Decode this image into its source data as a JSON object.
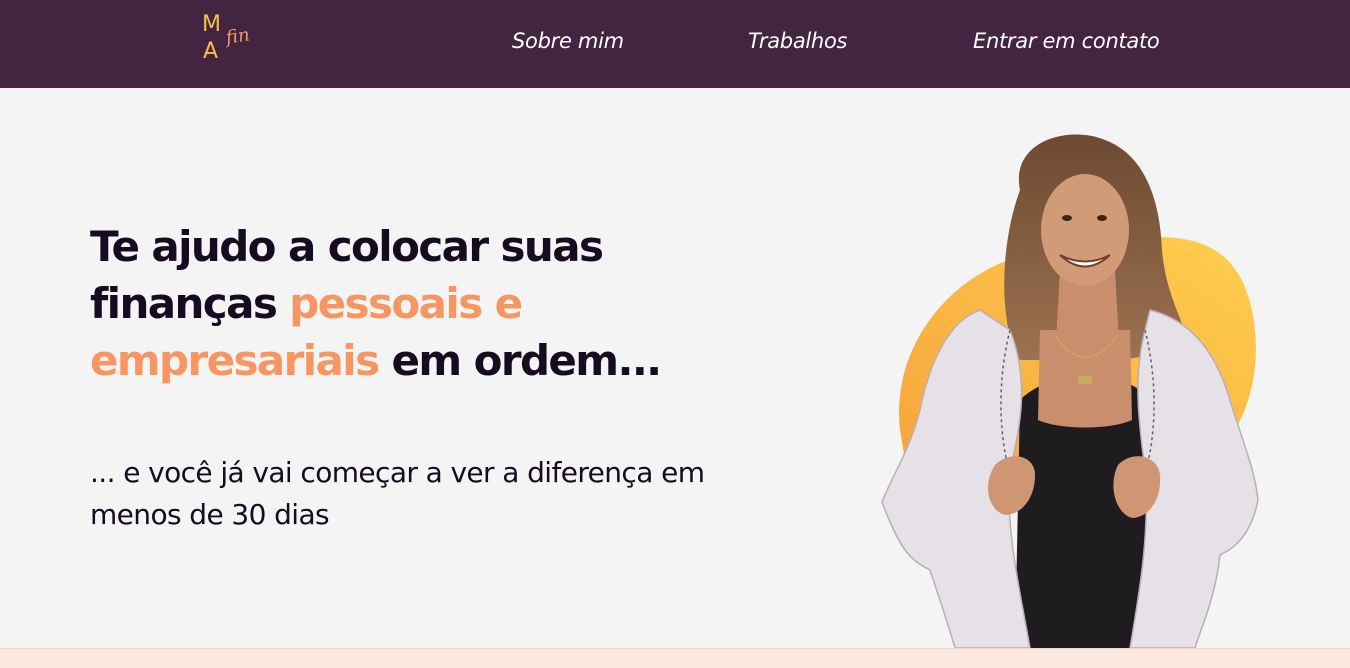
{
  "logo": {
    "letter_m": "M",
    "letter_a": "A",
    "script": "fin"
  },
  "nav": {
    "about": "Sobre mim",
    "works": "Trabalhos",
    "contact": "Entrar em contato"
  },
  "hero": {
    "headline_part1": "Te ajudo a colocar suas finanças ",
    "headline_accent": "pessoais e empresariais",
    "headline_part2": " em ordem...",
    "subline": "... e você já vai começar a ver a diferença em menos de 30 dias"
  },
  "colors": {
    "nav_bg": "#432542",
    "accent": "#f79661",
    "logo_gold": "#f4c14a",
    "page_bg": "#f4f4f4",
    "footer_band": "#fbe7dc"
  }
}
